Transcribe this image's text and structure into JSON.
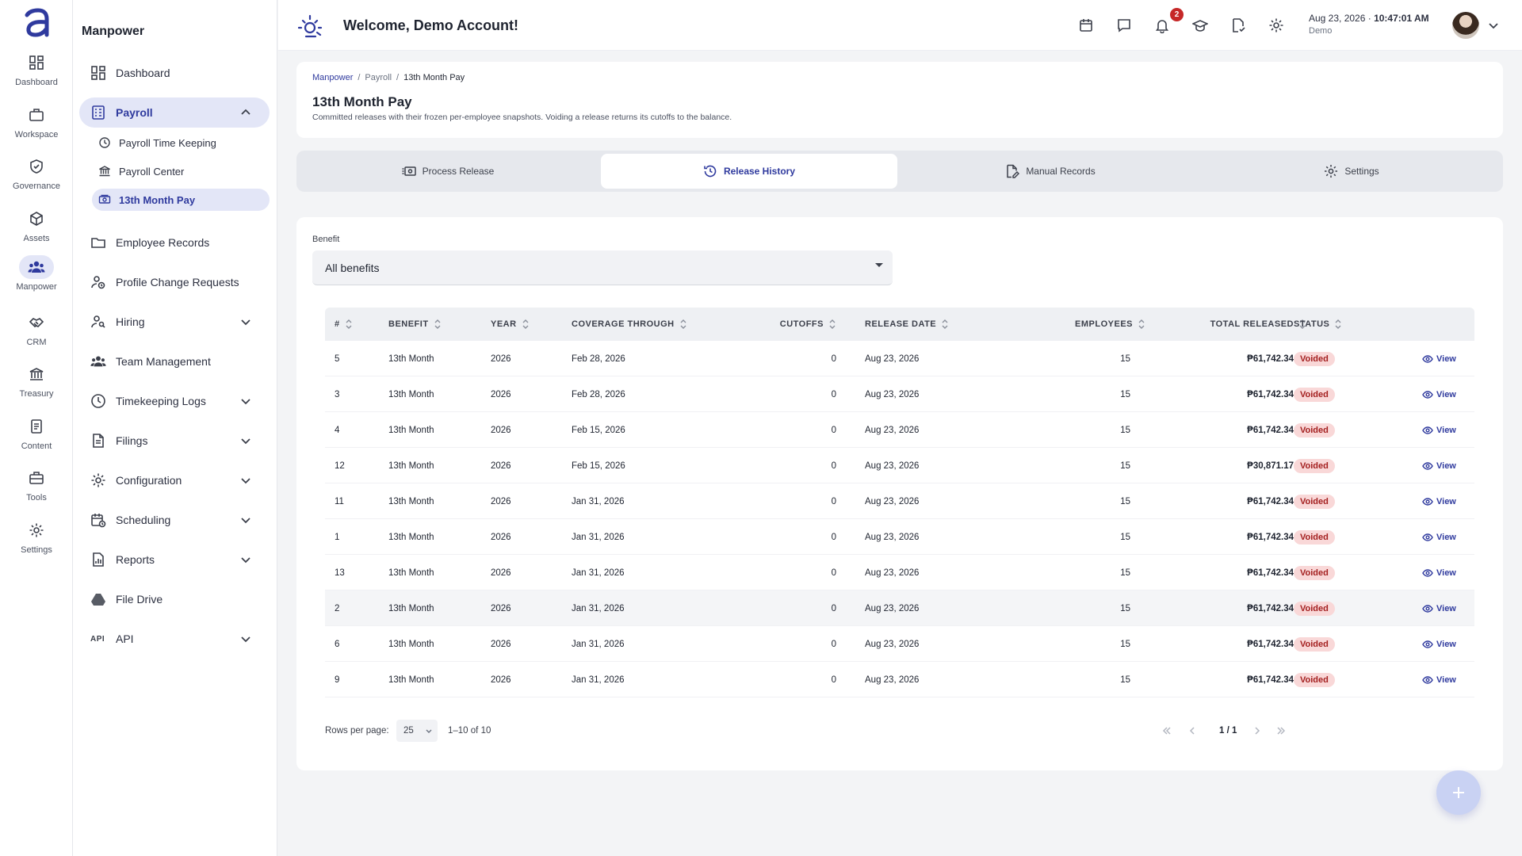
{
  "rail": {
    "items": [
      {
        "label": "Dashboard",
        "icon": "dashboard-icon"
      },
      {
        "label": "Workspace",
        "icon": "briefcase-icon"
      },
      {
        "label": "Governance",
        "icon": "shield-check-icon"
      },
      {
        "label": "Assets",
        "icon": "cube-icon"
      },
      {
        "label": "Manpower",
        "icon": "people-icon"
      },
      {
        "label": "CRM",
        "icon": "handshake-icon"
      },
      {
        "label": "Treasury",
        "icon": "bank-icon"
      },
      {
        "label": "Content",
        "icon": "document-icon"
      },
      {
        "label": "Tools",
        "icon": "toolbox-icon"
      },
      {
        "label": "Settings",
        "icon": "gear-icon"
      }
    ],
    "active": "Manpower"
  },
  "sidebar": {
    "title": "Manpower",
    "items": [
      {
        "label": "Dashboard"
      },
      {
        "label": "Payroll"
      },
      {
        "label": "Employee Records"
      },
      {
        "label": "Profile Change Requests"
      },
      {
        "label": "Hiring"
      },
      {
        "label": "Team Management"
      },
      {
        "label": "Timekeeping Logs"
      },
      {
        "label": "Filings"
      },
      {
        "label": "Configuration"
      },
      {
        "label": "Scheduling"
      },
      {
        "label": "Reports"
      },
      {
        "label": "File Drive"
      },
      {
        "label": "API"
      }
    ],
    "payroll_sub": [
      {
        "label": "Payroll Time Keeping"
      },
      {
        "label": "Payroll Center"
      },
      {
        "label": "13th Month Pay"
      }
    ],
    "api_icon_text": "API"
  },
  "topbar": {
    "welcome": "Welcome, Demo Account!",
    "notification_count": "2",
    "date": "Aug 23, 2026",
    "time": "10:47:01 AM",
    "user": "Demo"
  },
  "breadcrumb": [
    "Manpower",
    "Payroll",
    "13th Month Pay"
  ],
  "page": {
    "title": "13th Month Pay",
    "description": "Committed releases with their frozen per-employee snapshots. Voiding a release returns its cutoffs to the balance."
  },
  "tabs": [
    {
      "label": "Process Release"
    },
    {
      "label": "Release History"
    },
    {
      "label": "Manual Records"
    },
    {
      "label": "Settings"
    }
  ],
  "active_tab": "Release History",
  "filter": {
    "label": "Benefit",
    "value": "All benefits"
  },
  "table": {
    "columns": [
      "#",
      "Benefit",
      "Year",
      "Coverage Through",
      "Cutoffs",
      "Release Date",
      "Employees",
      "Total Released",
      "Status"
    ],
    "rows": [
      {
        "id": "5",
        "benefit": "13th Month",
        "year": "2026",
        "coverage": "Feb 28, 2026",
        "cutoffs": "0",
        "release_date": "Aug 23, 2026",
        "employees": "15",
        "total": "₱61,742.34",
        "status": "Voided",
        "action": "View"
      },
      {
        "id": "3",
        "benefit": "13th Month",
        "year": "2026",
        "coverage": "Feb 28, 2026",
        "cutoffs": "0",
        "release_date": "Aug 23, 2026",
        "employees": "15",
        "total": "₱61,742.34",
        "status": "Voided",
        "action": "View"
      },
      {
        "id": "4",
        "benefit": "13th Month",
        "year": "2026",
        "coverage": "Feb 15, 2026",
        "cutoffs": "0",
        "release_date": "Aug 23, 2026",
        "employees": "15",
        "total": "₱61,742.34",
        "status": "Voided",
        "action": "View"
      },
      {
        "id": "12",
        "benefit": "13th Month",
        "year": "2026",
        "coverage": "Feb 15, 2026",
        "cutoffs": "0",
        "release_date": "Aug 23, 2026",
        "employees": "15",
        "total": "₱30,871.17",
        "status": "Voided",
        "action": "View"
      },
      {
        "id": "11",
        "benefit": "13th Month",
        "year": "2026",
        "coverage": "Jan 31, 2026",
        "cutoffs": "0",
        "release_date": "Aug 23, 2026",
        "employees": "15",
        "total": "₱61,742.34",
        "status": "Voided",
        "action": "View"
      },
      {
        "id": "1",
        "benefit": "13th Month",
        "year": "2026",
        "coverage": "Jan 31, 2026",
        "cutoffs": "0",
        "release_date": "Aug 23, 2026",
        "employees": "15",
        "total": "₱61,742.34",
        "status": "Voided",
        "action": "View"
      },
      {
        "id": "13",
        "benefit": "13th Month",
        "year": "2026",
        "coverage": "Jan 31, 2026",
        "cutoffs": "0",
        "release_date": "Aug 23, 2026",
        "employees": "15",
        "total": "₱61,742.34",
        "status": "Voided",
        "action": "View"
      },
      {
        "id": "2",
        "benefit": "13th Month",
        "year": "2026",
        "coverage": "Jan 31, 2026",
        "cutoffs": "0",
        "release_date": "Aug 23, 2026",
        "employees": "15",
        "total": "₱61,742.34",
        "status": "Voided",
        "action": "View"
      },
      {
        "id": "6",
        "benefit": "13th Month",
        "year": "2026",
        "coverage": "Jan 31, 2026",
        "cutoffs": "0",
        "release_date": "Aug 23, 2026",
        "employees": "15",
        "total": "₱61,742.34",
        "status": "Voided",
        "action": "View"
      },
      {
        "id": "9",
        "benefit": "13th Month",
        "year": "2026",
        "coverage": "Jan 31, 2026",
        "cutoffs": "0",
        "release_date": "Aug 23, 2026",
        "employees": "15",
        "total": "₱61,742.34",
        "status": "Voided",
        "action": "View"
      }
    ]
  },
  "pagination": {
    "rows_per_page_label": "Rows per page:",
    "rows_per_page": "25",
    "range": "1–10 of 10",
    "page": "1 / 1"
  },
  "colors": {
    "accent": "#2f3a9e",
    "active_bg": "#e3e6f7",
    "voided_bg": "#f9d8d8",
    "voided_text": "#a42020",
    "notification": "#c62828"
  }
}
